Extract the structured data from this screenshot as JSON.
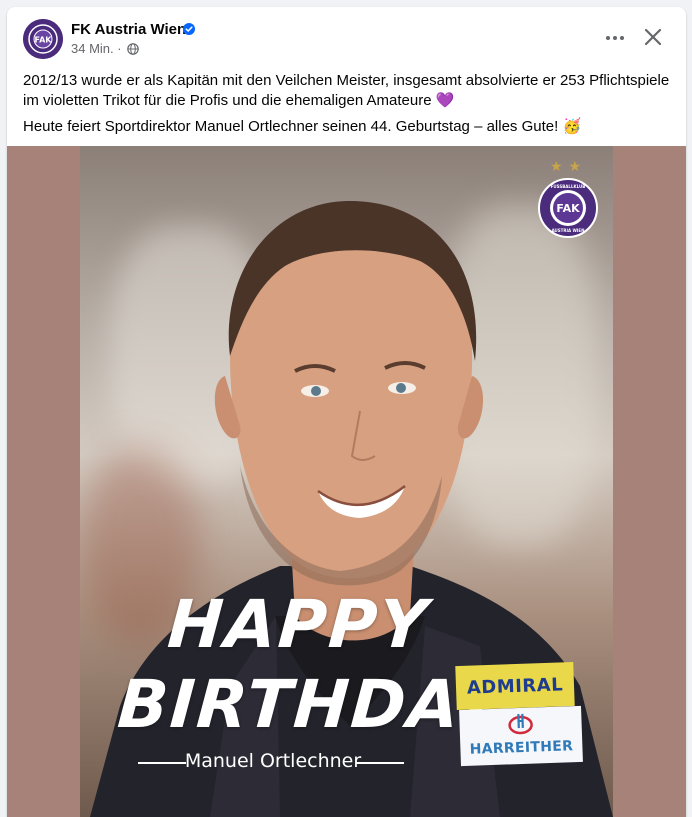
{
  "post": {
    "page_name": "FK Austria Wien",
    "time": "34 Min.",
    "separator": "·",
    "text_line1": "2012/13 wurde er als Kapitän mit den Veilchen Meister, insgesamt absolvierte er 253 Pflichtspiele im violetten Trikot für die Profis und die ehemaligen Amateure 💜",
    "text_line2": "Heute feiert Sportdirektor Manuel Ortlechner seinen 44. Geburtstag – alles Gute! 🥳"
  },
  "image": {
    "headline_1": "HAPPY",
    "headline_2": "BIRTHDAY",
    "name": "Manuel Ortlechner",
    "stars": "★★",
    "crest_text_top": "FUSSBALLKLUB",
    "crest_text_bottom": "AUSTRIA WIEN",
    "crest_letters": "FAK",
    "sponsor_1": "ADMIRAL",
    "sponsor_2": "HARREITHER"
  },
  "colors": {
    "club_violet": "#4a2b7c",
    "verified_blue": "#0866ff",
    "media_background": "#a78278",
    "sponsor_yellow": "#e9d84a"
  },
  "icons": {
    "verified": "verified-badge-icon",
    "audience": "globe-icon",
    "more": "more-options-icon",
    "close": "close-icon"
  }
}
